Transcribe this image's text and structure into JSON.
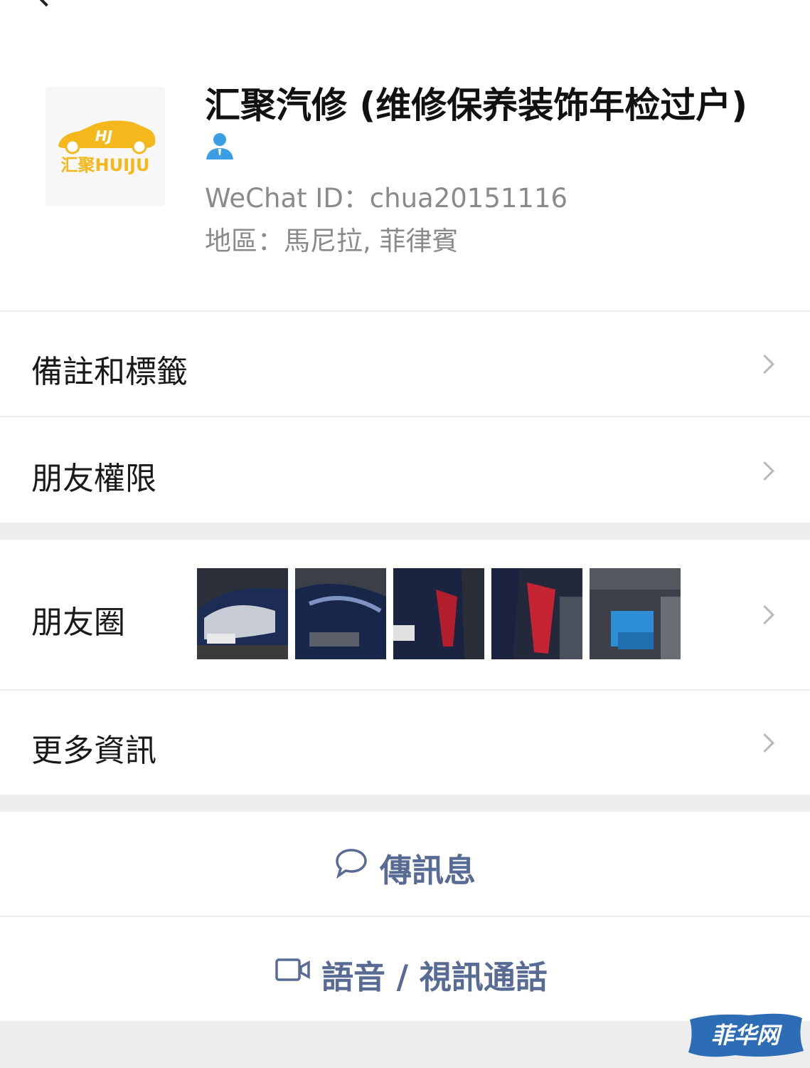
{
  "profile": {
    "name": "汇聚汽修 (维修保养装饰年检过户)",
    "avatar_logo_text": "汇聚HUIJU",
    "avatar_badge_text": "HJ",
    "wechat_id": "WeChat ID：chua20151116",
    "region": "地區：馬尼拉, 菲律賓"
  },
  "menu": {
    "remarks_tags": "備註和標籤",
    "friend_permissions": "朋友權限",
    "moments": "朋友圈",
    "more_info": "更多資訊"
  },
  "actions": {
    "send_message": "傳訊息",
    "voice_video_call": "語音 / 視訊通話"
  },
  "icons": {
    "back": "chevron-left-icon",
    "contact": "person-icon",
    "row_arrow": "chevron-right-icon",
    "message": "chat-bubble-icon",
    "video": "video-camera-icon"
  },
  "colors": {
    "link_blue": "#576b95",
    "avatar_yellow": "#f4b81d",
    "person_icon_blue": "#3a9ee3",
    "background": "#ededed"
  },
  "watermark": "菲华网"
}
